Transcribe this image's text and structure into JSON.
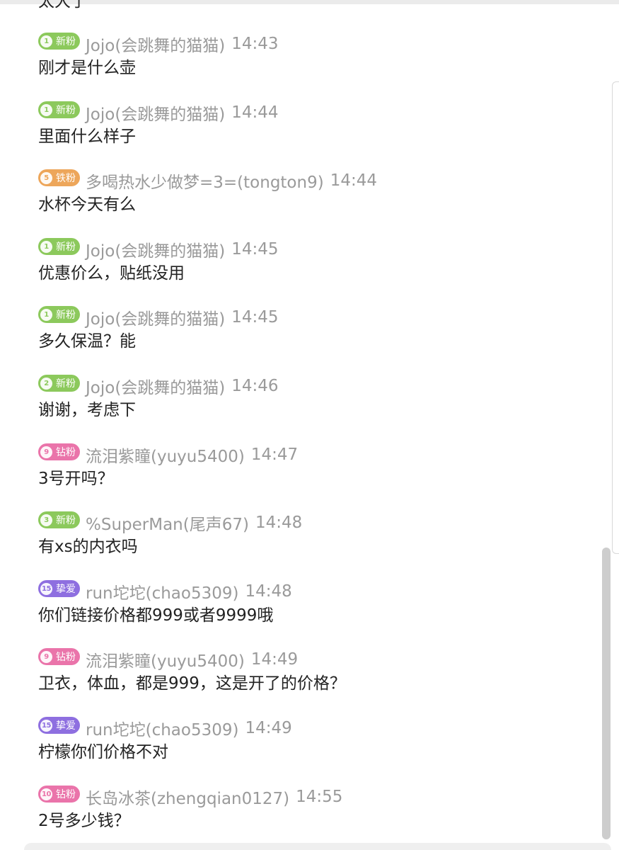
{
  "chat": {
    "cut_message": "太大了",
    "messages": [
      {
        "badge": {
          "level": "1",
          "label": "新粉",
          "color": "#8cc95c"
        },
        "user": "Jojo(会跳舞的猫猫)",
        "time": "14:43",
        "text": "刚才是什么壶"
      },
      {
        "badge": {
          "level": "1",
          "label": "新粉",
          "color": "#8cc95c"
        },
        "user": "Jojo(会跳舞的猫猫)",
        "time": "14:44",
        "text": "里面什么样子"
      },
      {
        "badge": {
          "level": "5",
          "label": "铁粉",
          "color": "#eda65a"
        },
        "user": "多喝热水少做梦=3=(tongton9)",
        "time": "14:44",
        "text": "水杯今天有么"
      },
      {
        "badge": {
          "level": "1",
          "label": "新粉",
          "color": "#8cc95c"
        },
        "user": "Jojo(会跳舞的猫猫)",
        "time": "14:45",
        "text": "优惠价么，贴纸没用"
      },
      {
        "badge": {
          "level": "1",
          "label": "新粉",
          "color": "#8cc95c"
        },
        "user": "Jojo(会跳舞的猫猫)",
        "time": "14:45",
        "text": "多久保温？能"
      },
      {
        "badge": {
          "level": "2",
          "label": "新粉",
          "color": "#8cc95c"
        },
        "user": "Jojo(会跳舞的猫猫)",
        "time": "14:46",
        "text": "谢谢，考虑下"
      },
      {
        "badge": {
          "level": "9",
          "label": "钻粉",
          "color": "#ea74aa"
        },
        "user": "流泪紫瞳(yuyu5400)",
        "time": "14:47",
        "text": "3号开吗？"
      },
      {
        "badge": {
          "level": "3",
          "label": "新粉",
          "color": "#8cc95c"
        },
        "user": "%SuperMan(尾声67)",
        "time": "14:48",
        "text": "有xs的内衣吗"
      },
      {
        "badge": {
          "level": "15",
          "label": "挚爱",
          "color": "#8e6fe0"
        },
        "user": "run坨坨(chao5309)",
        "time": "14:48",
        "text": "你们链接价格都999或者9999哦"
      },
      {
        "badge": {
          "level": "9",
          "label": "钻粉",
          "color": "#ea74aa"
        },
        "user": "流泪紫瞳(yuyu5400)",
        "time": "14:49",
        "text": "卫衣，体血，都是999，这是开了的价格？"
      },
      {
        "badge": {
          "level": "15",
          "label": "挚爱",
          "color": "#8e6fe0"
        },
        "user": "run坨坨(chao5309)",
        "time": "14:49",
        "text": "柠檬你们价格不对"
      },
      {
        "badge": {
          "level": "10",
          "label": "钻粉",
          "color": "#ea74aa"
        },
        "user": "长岛冰茶(zhengqian0127)",
        "time": "14:55",
        "text": "2号多少钱？"
      }
    ]
  }
}
